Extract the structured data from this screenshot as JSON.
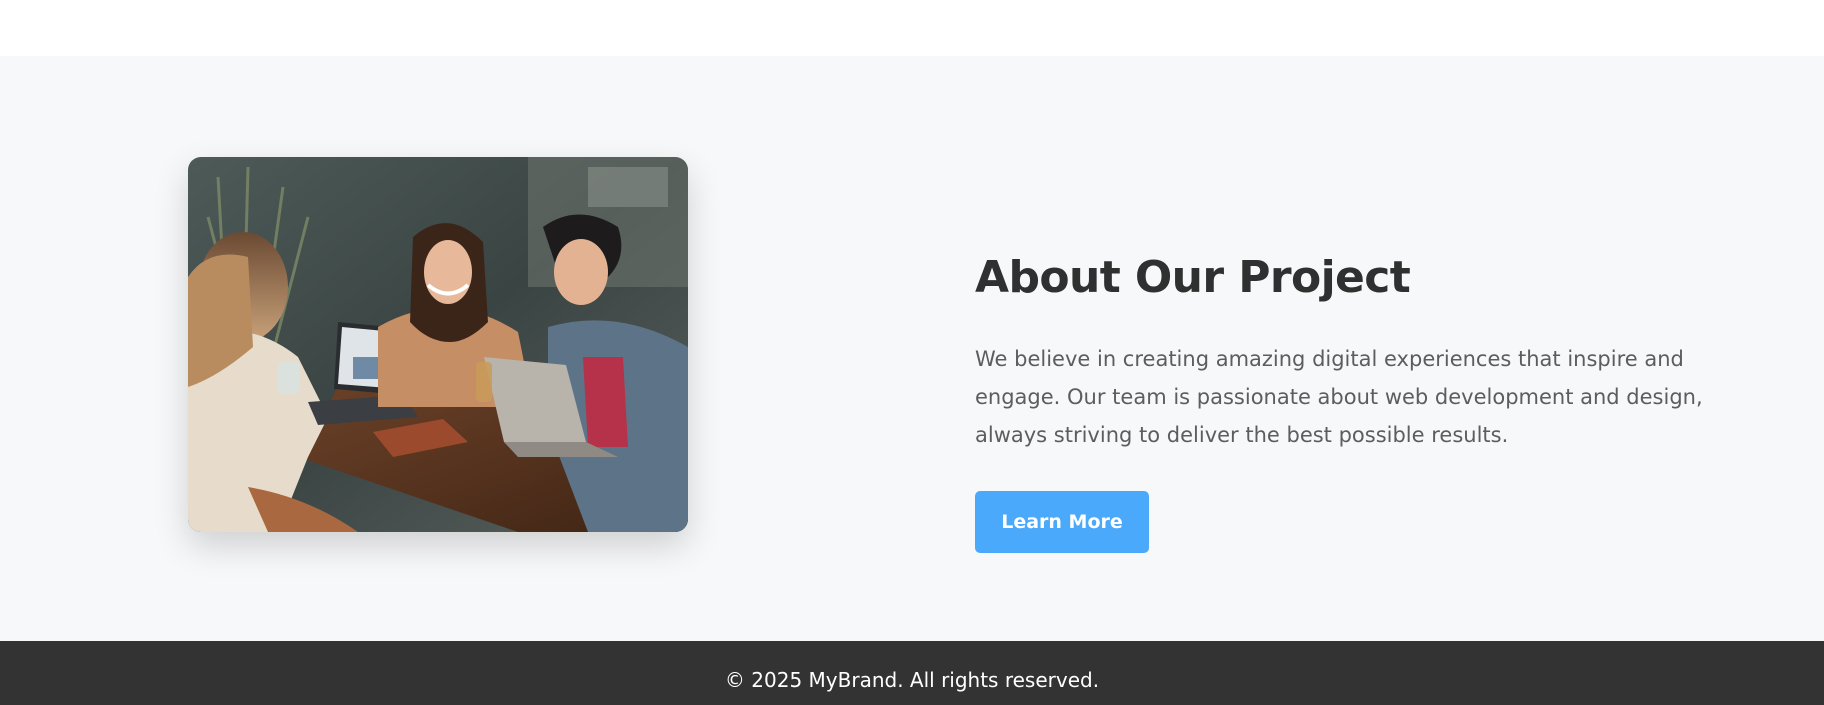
{
  "about": {
    "image_alt": "Three people smiling and working together at a wooden table with laptops",
    "title": "About Our Project",
    "body": "We believe in creating amazing digital experiences that inspire and engage. Our team is passionate about web development and design, always striving to deliver the best possible results.",
    "button_label": "Learn More"
  },
  "footer": {
    "copyright": "© 2025 MyBrand. All rights reserved."
  },
  "colors": {
    "section_background": "#f7f8f9",
    "title": "#2f3030",
    "body_text": "#5b5d5e",
    "button": "#4aa9fb",
    "footer_background": "#333333"
  }
}
